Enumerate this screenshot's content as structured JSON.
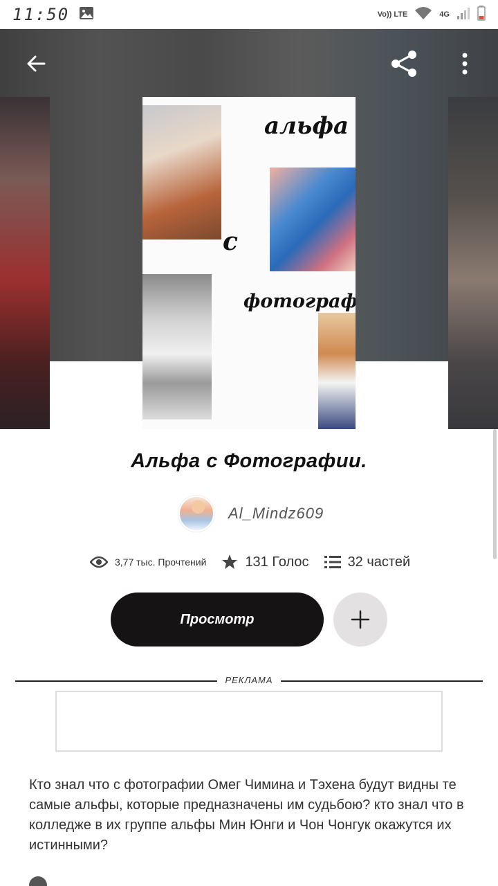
{
  "status_bar": {
    "time": "11:50",
    "volte_label": "Vo)) LTE",
    "network_label": "4G"
  },
  "icons": {
    "back": "arrow-left-icon",
    "share": "share-icon",
    "more": "more-vertical-icon",
    "views": "eye-icon",
    "votes": "star-icon",
    "parts": "list-icon",
    "add": "plus-icon"
  },
  "cover": {
    "word1": "альфа",
    "word2": "с",
    "word3": "фотографии"
  },
  "book": {
    "title": "Альфа с Фотографии.",
    "author": "Al_Mindz609"
  },
  "stats": {
    "reads": "3,77 тыс. Прочтений",
    "votes": "131 Голос",
    "parts": "32 частей"
  },
  "actions": {
    "read_label": "Просмотр"
  },
  "ad": {
    "label": "РЕКЛАМА"
  },
  "description": "Кто знал что с фотографии Омег Чимина и Тэхена будут видны те самые альфы, которые предназначены им судьбою? кто знал что в колледже в их группе альфы Мин Юнги и Чон Чонгук окажутся их истинными?",
  "colors": {
    "primary_button": "#161314",
    "secondary_button": "#e3e1e2",
    "text": "#333333"
  }
}
